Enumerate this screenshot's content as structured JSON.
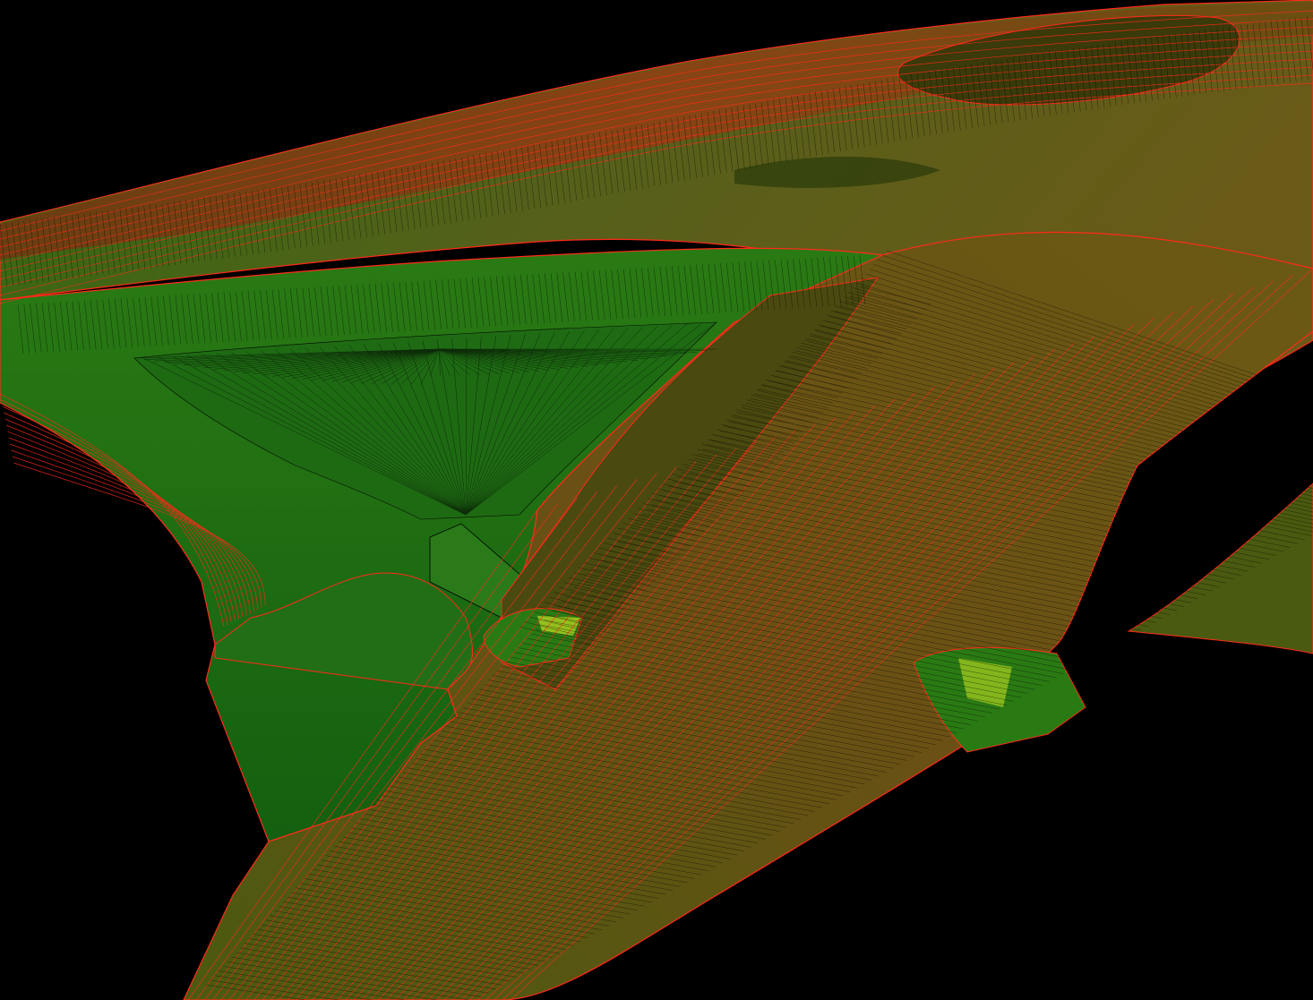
{
  "scene": {
    "description_kind": "3d-tin-surface-render",
    "colors": {
      "background": "#000000",
      "surface_green": "#1f6f12",
      "surface_dark_green": "#0f4a08",
      "surface_olive": "#5a5a10",
      "surface_brown": "#6a4a14",
      "edge_red": "#ff2a1a",
      "edge_black": "#000000",
      "highlight_yellow": "#b8d820"
    }
  }
}
